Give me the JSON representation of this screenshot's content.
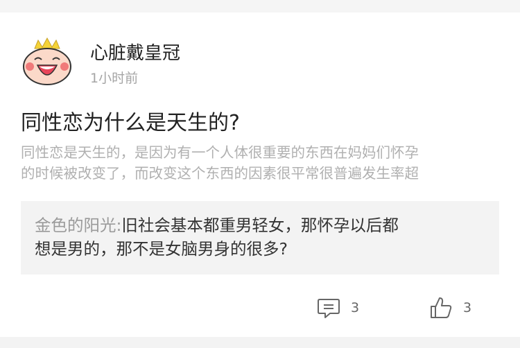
{
  "post": {
    "author": "心脏戴皇冠",
    "time": "1小时前",
    "title": "同性恋为什么是天生的?",
    "excerpt_lines": [
      "同性恋是天生的，是因为有一个人体很重要的东西在妈妈们怀孕",
      "的时候被改变了，而改变这个东西的因素很平常很普遍发生率超"
    ]
  },
  "comment": {
    "author": "金色的阳光",
    "separator": ":",
    "text_line1": "旧社会基本都重男轻女，那怀孕以后都",
    "text_line2": "想是男的，那不是女脑男身的很多?"
  },
  "actions": {
    "comment_icon": "comment-bubble-icon",
    "comment_count": "3",
    "like_icon": "thumbs-up-icon",
    "like_count": "3"
  },
  "colors": {
    "text_primary": "#222222",
    "text_muted": "#a5a5a5",
    "comment_bg": "#f3f3f3",
    "avatar_face": "#fbd9c9",
    "avatar_crown": "#f5d337"
  }
}
